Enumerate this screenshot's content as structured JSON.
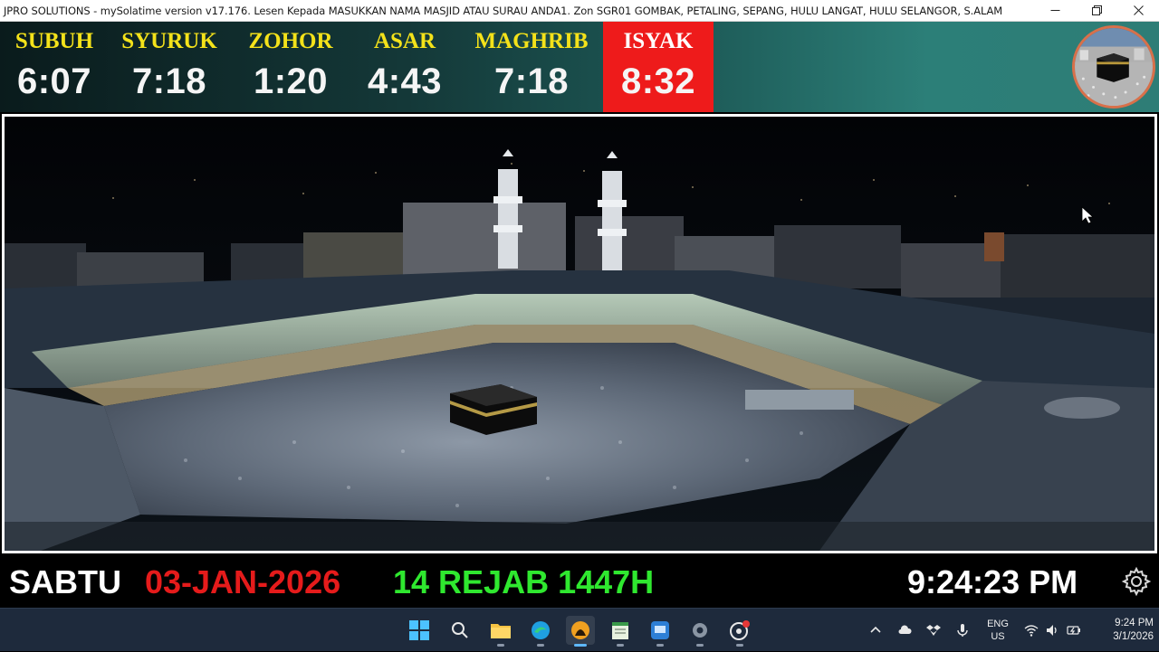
{
  "window": {
    "title": "JPRO SOLUTIONS - mySolatime version v17.176. Lesen Kepada MASUKKAN NAMA MASJID ATAU SURAU ANDA1. Zon SGR01 GOMBAK, PETALING, SEPANG, HULU LANGAT, HULU SELANGOR, S.ALAM"
  },
  "prayers": [
    {
      "name": "SUBUH",
      "time": "6:07"
    },
    {
      "name": "SYURUK",
      "time": "7:18"
    },
    {
      "name": "ZOHOR",
      "time": "1:20"
    },
    {
      "name": "ASAR",
      "time": "4:43"
    },
    {
      "name": "MAGHRIB",
      "time": "7:18"
    },
    {
      "name": "ISYAK",
      "time": "8:32"
    }
  ],
  "active_prayer": "ISYAK",
  "datebar": {
    "day": "SABTU",
    "gregorian": "03-JAN-2026",
    "hijri": "14 REJAB 1447H",
    "clock": "9:24:23 PM"
  },
  "taskbar": {
    "apps": [
      "windows-start",
      "search",
      "file-explorer",
      "edge",
      "mysolatime",
      "notepad",
      "remote-desktop",
      "settings",
      "snipping-tool"
    ],
    "tray": {
      "lang_line1": "ENG",
      "lang_line2": "US",
      "time": "9:24 PM",
      "date": "3/1/2026"
    }
  },
  "colors": {
    "prayer_name": "#f4e21a",
    "prayer_time": "#f5f5f5",
    "active_bg": "#ee1b1b",
    "gregorian": "#e51b1b",
    "hijri": "#2fe82f"
  }
}
